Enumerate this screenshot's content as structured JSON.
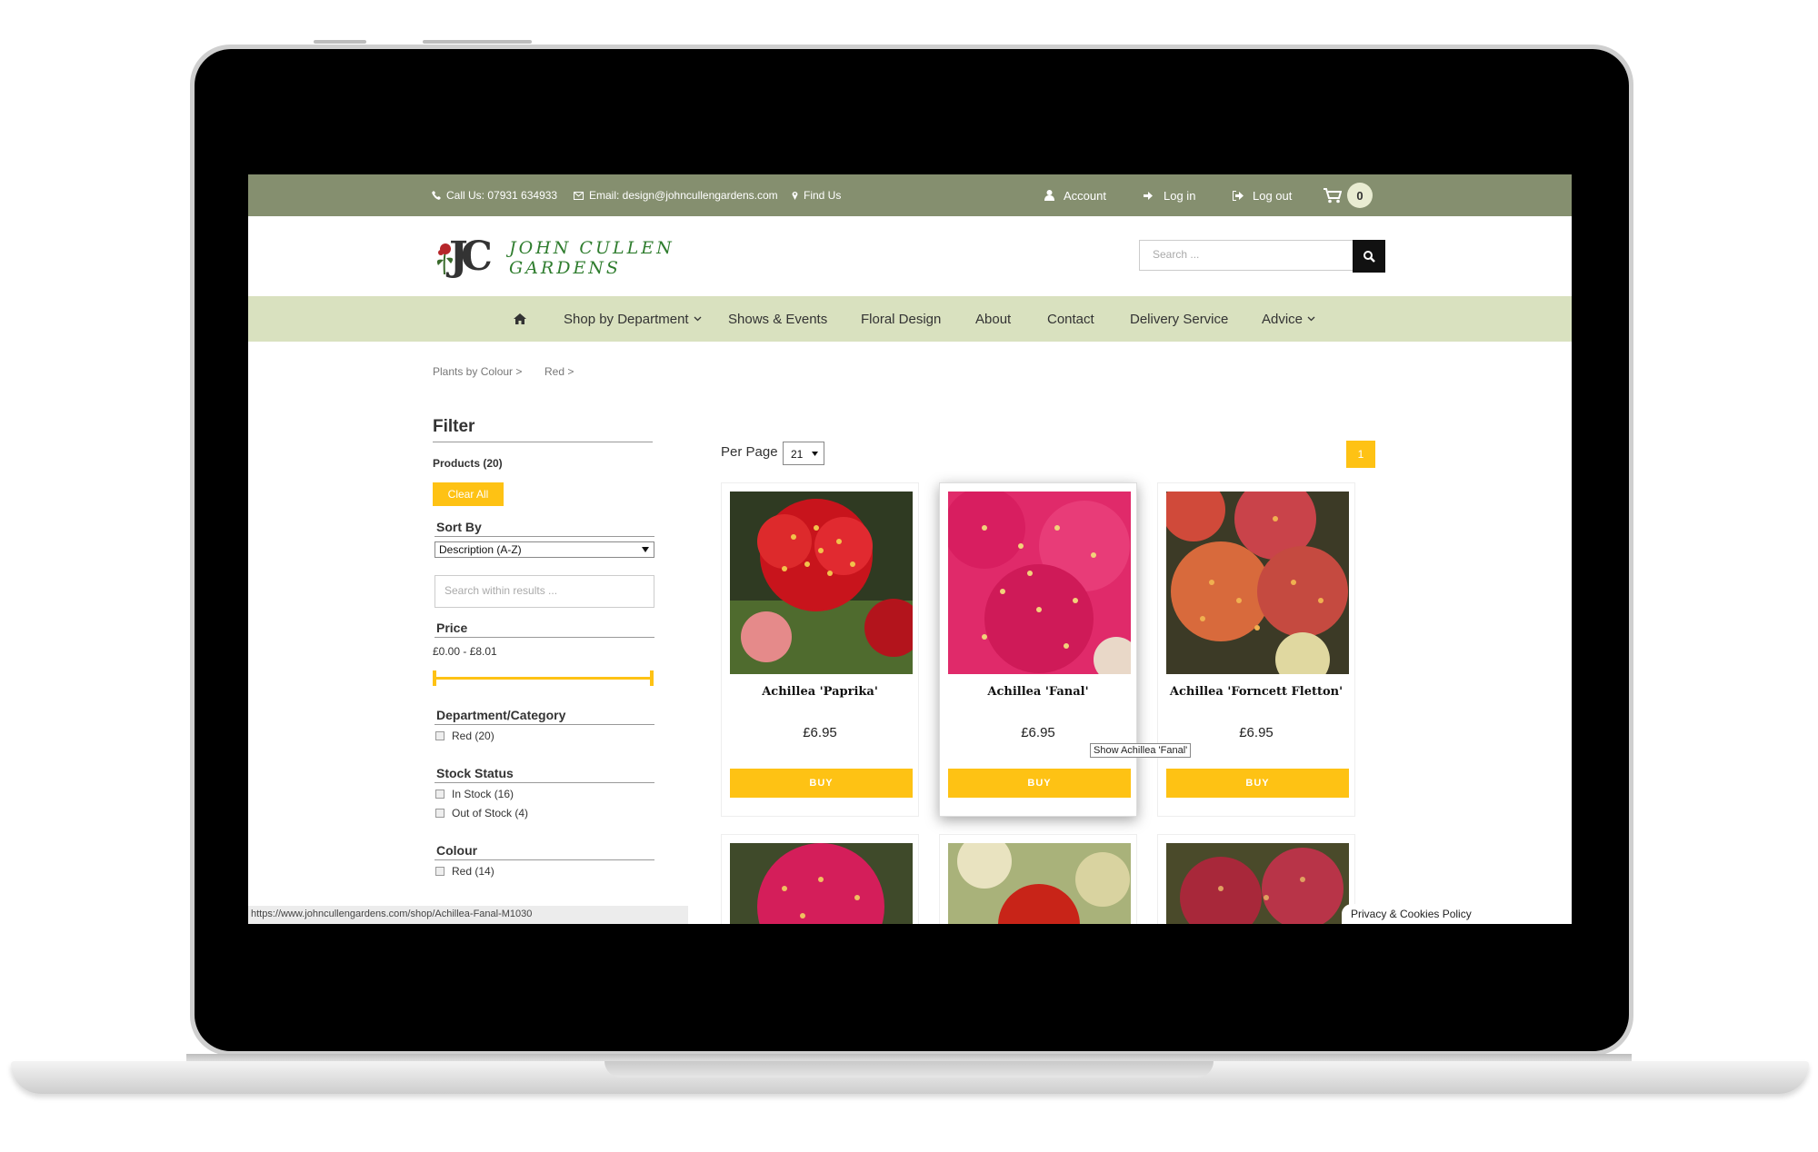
{
  "topbar": {
    "call": "Call Us: 07931 634933",
    "email": "Email: design@johncullengardens.com",
    "find": "Find Us",
    "account": "Account",
    "login": "Log in",
    "logout": "Log out",
    "cart_count": "0"
  },
  "logo": {
    "monogram": "JC",
    "line1": "JOHN CULLEN",
    "line2": "GARDENS"
  },
  "search": {
    "placeholder": "Search ..."
  },
  "nav": {
    "shop": "Shop by Department",
    "shows": "Shows & Events",
    "floral": "Floral Design",
    "about": "About",
    "contact": "Contact",
    "delivery": "Delivery Service",
    "advice": "Advice"
  },
  "breadcrumb": {
    "level1": "Plants by Colour >",
    "level2": "Red >"
  },
  "filter": {
    "title": "Filter",
    "products": "Products (20)",
    "clear": "Clear All",
    "sort_title": "Sort By",
    "sort_value": "Description (A-Z)",
    "search_placeholder": "Search within results ...",
    "price_title": "Price",
    "price_range": "£0.00 - £8.01",
    "dept_title": "Department/Category",
    "dept_red": "Red (20)",
    "stock_title": "Stock Status",
    "in_stock": "In Stock (16)",
    "out_stock": "Out of Stock (4)",
    "colour_title": "Colour",
    "colour_red": "Red (14)"
  },
  "listing": {
    "per_page_label": "Per Page",
    "per_page_value": "21",
    "page": "1"
  },
  "products": [
    {
      "name": "Achillea 'Paprika'",
      "price": "£6.95",
      "buy": "BUY"
    },
    {
      "name": "Achillea 'Fanal'",
      "price": "£6.95",
      "buy": "BUY"
    },
    {
      "name": "Achillea 'Forncett Fletton'",
      "price": "£6.95",
      "buy": "BUY"
    }
  ],
  "tooltip": "Show Achillea 'Fanal'",
  "status_url": "https://www.johncullengardens.com/shop/Achillea-Fanal-M1030",
  "cookie": "Privacy & Cookies Policy",
  "colors": {
    "topbar": "#858f6f",
    "nav": "#d9e1bf",
    "accent": "#fec214"
  }
}
